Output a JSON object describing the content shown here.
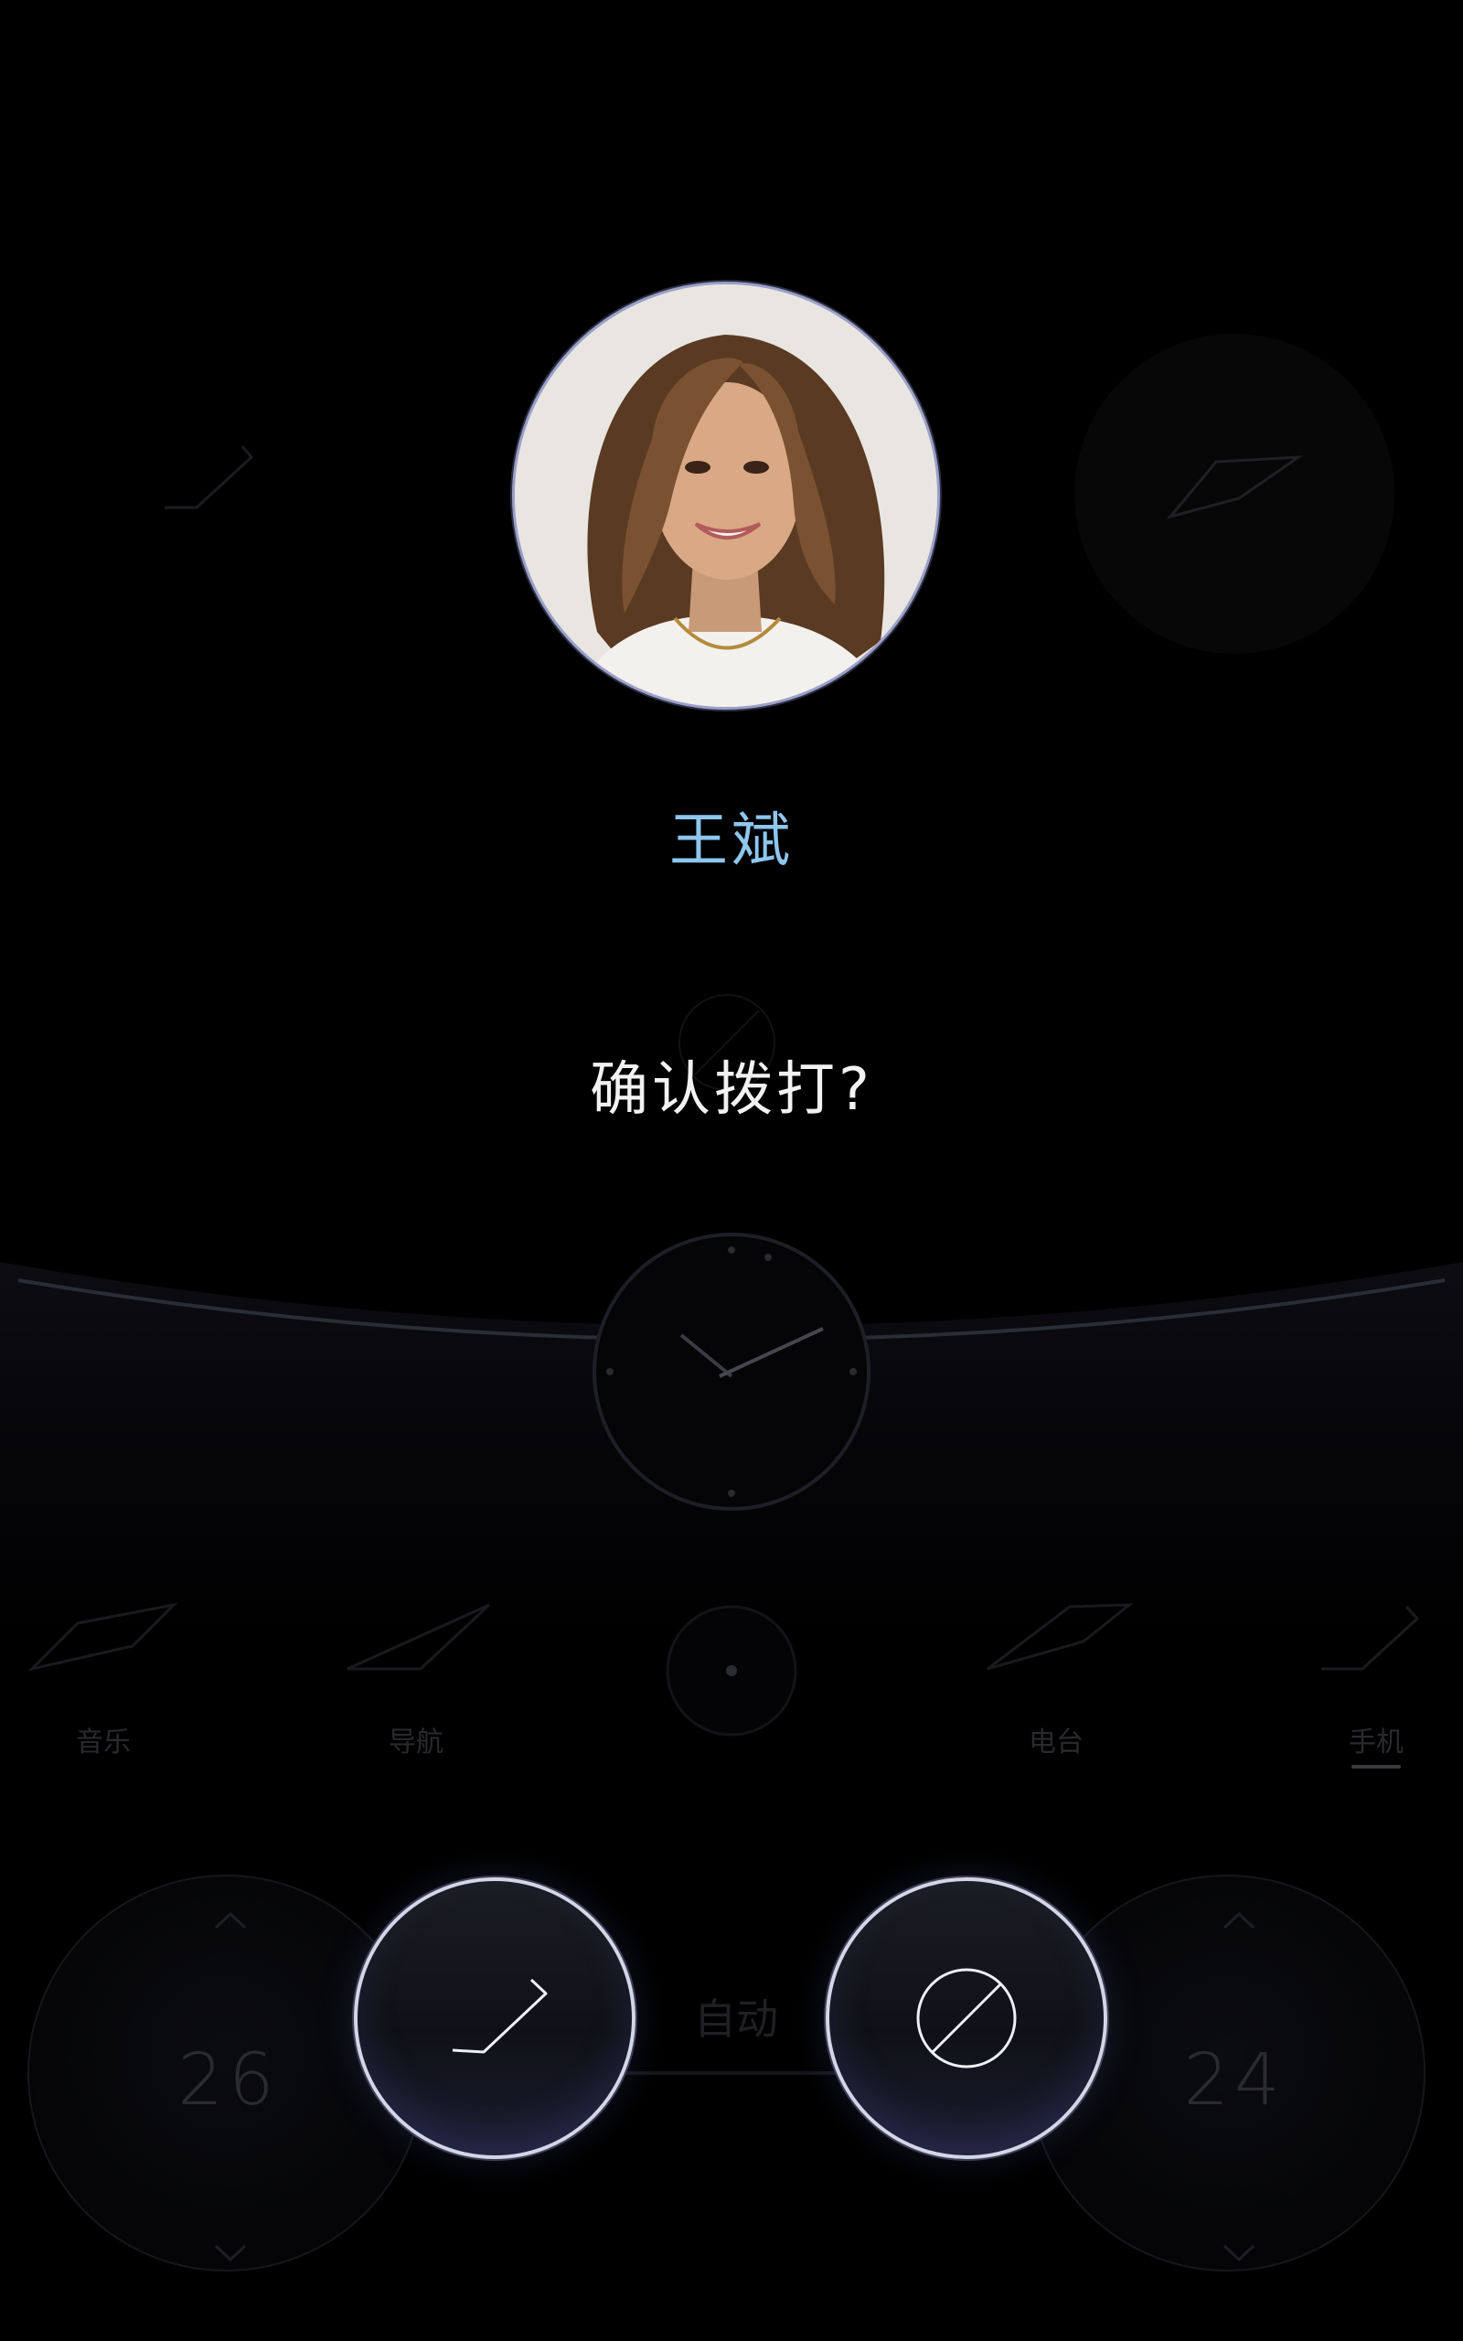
{
  "dialog": {
    "contact_name": "王斌",
    "confirm_prompt": "确认拨打?",
    "call_icon": "phone-handset-icon",
    "cancel_icon": "cancel-slash-icon"
  },
  "background": {
    "nav_items": [
      {
        "label": "音乐",
        "icon": "music-icon"
      },
      {
        "label": "导航",
        "icon": "navigation-icon"
      },
      {
        "label": "",
        "icon": "home-dot-icon"
      },
      {
        "label": "电台",
        "icon": "radio-icon"
      },
      {
        "label": "手机",
        "icon": "phone-icon",
        "active": true
      }
    ],
    "climate": {
      "left_temp": "26",
      "right_temp": "24",
      "mode": "自动"
    }
  },
  "colors": {
    "background": "#000000",
    "name_accent": "#8ec6ee",
    "prompt_text": "#f2f2f2",
    "button_ring": "#d4d6e6"
  }
}
